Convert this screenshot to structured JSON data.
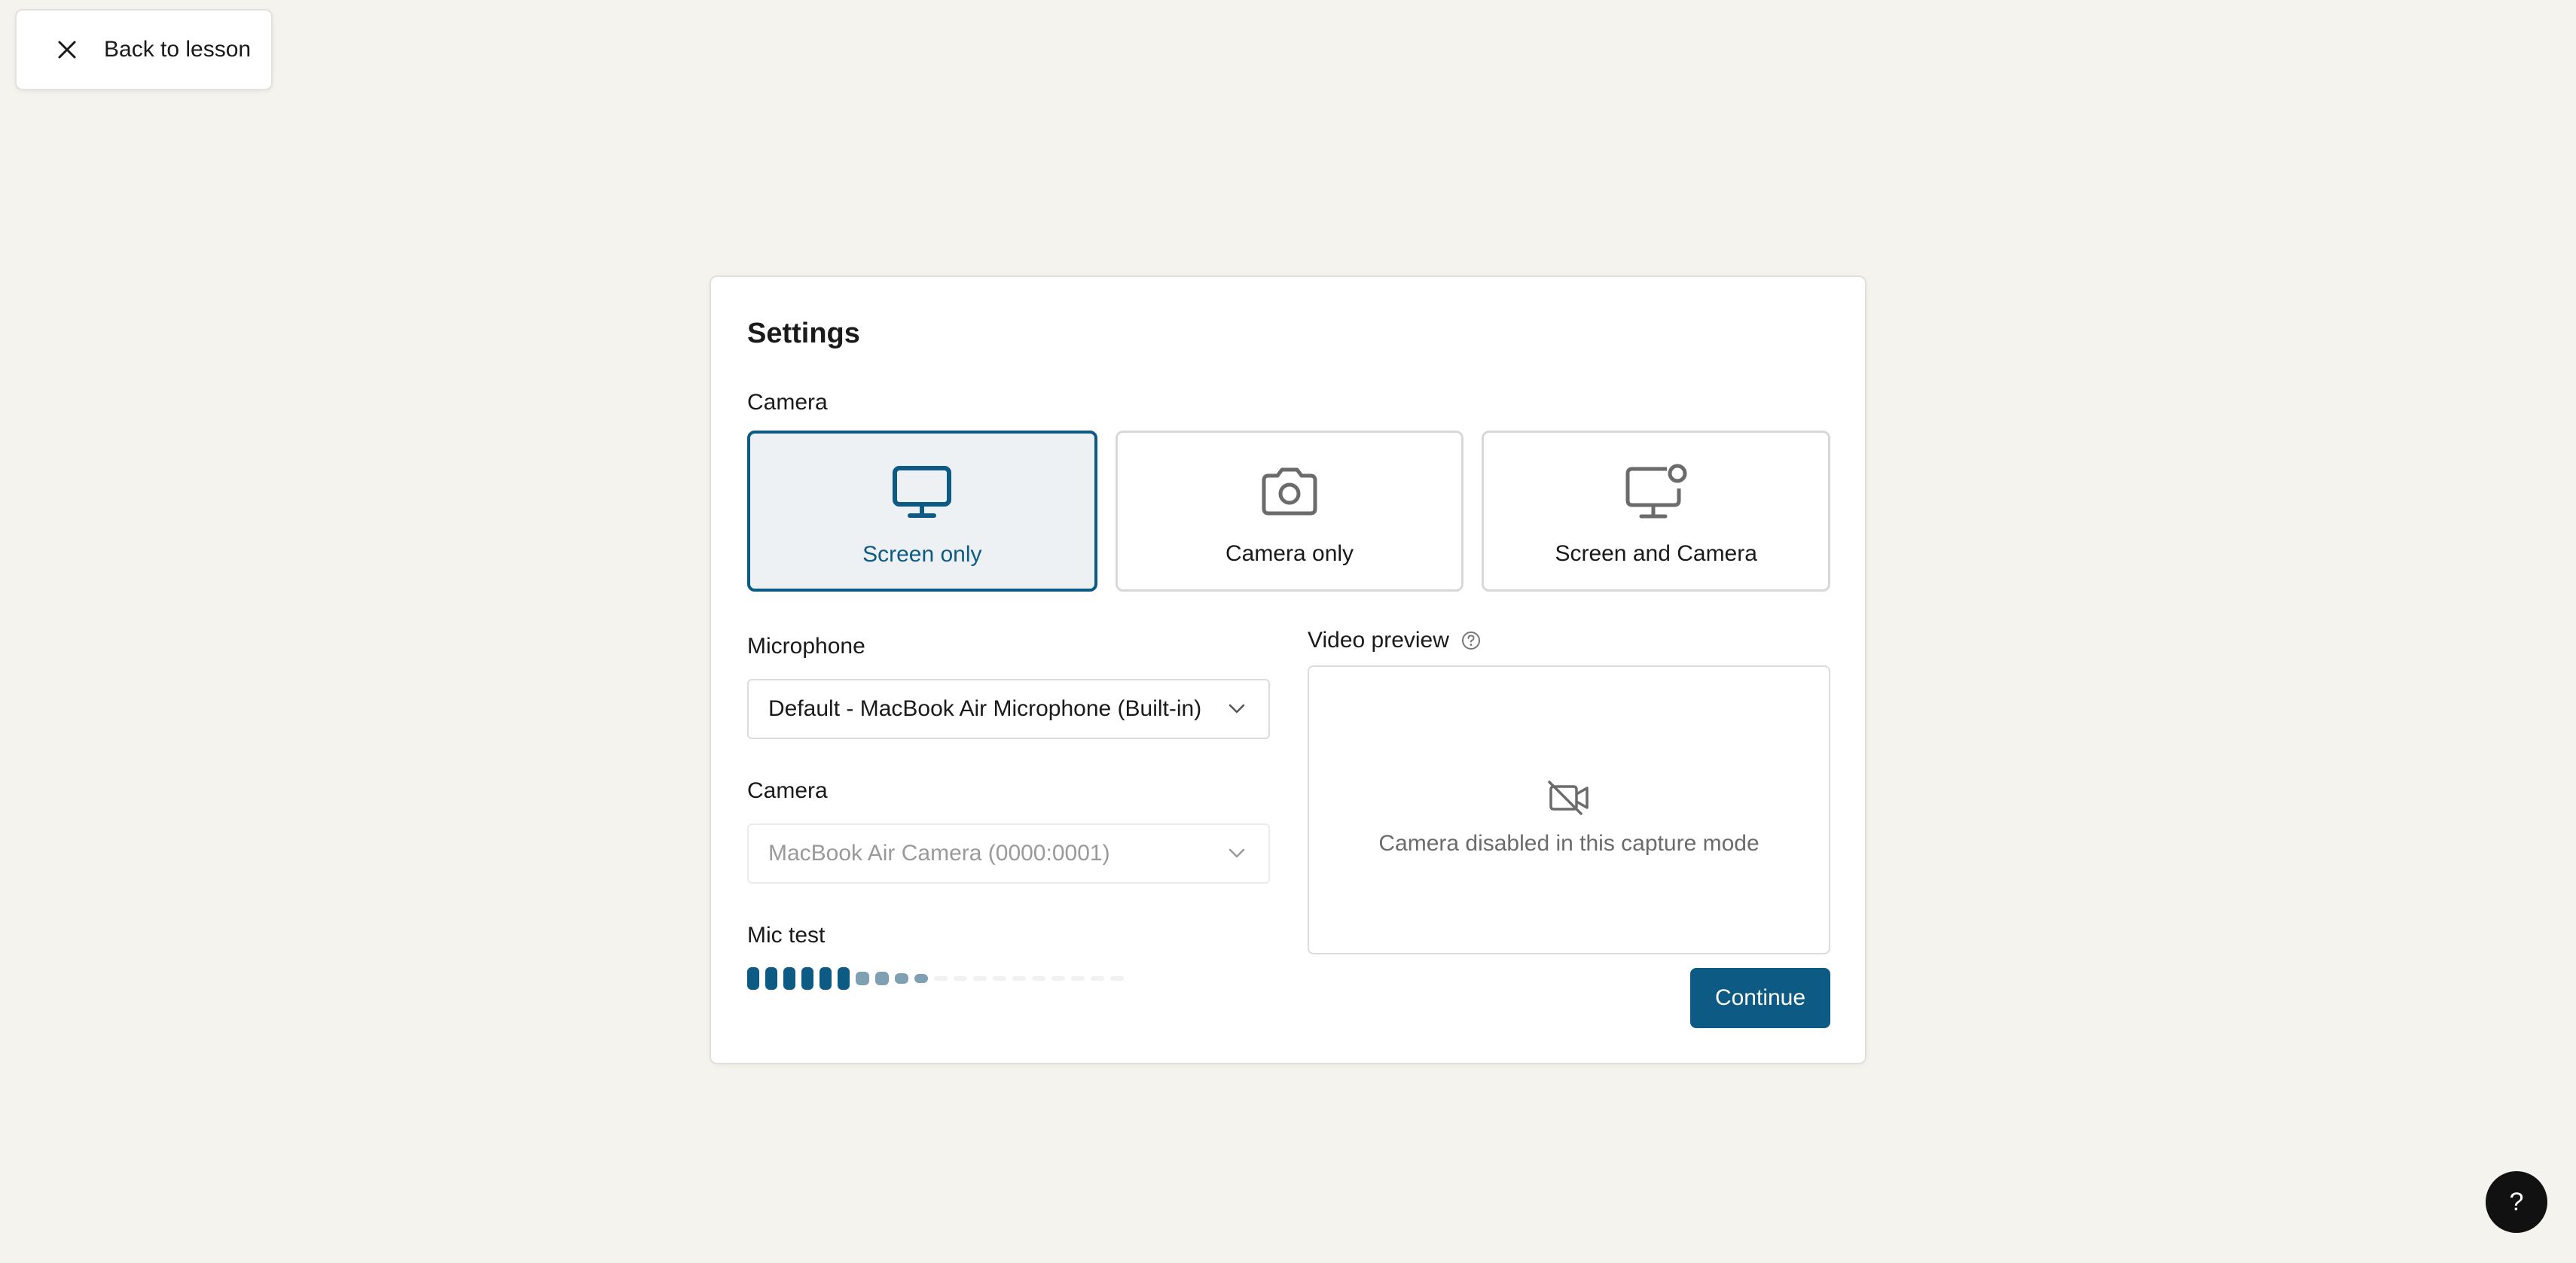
{
  "back_button": {
    "label": "Back to lesson",
    "icon": "close-icon"
  },
  "settings": {
    "title": "Settings",
    "camera_mode_label": "Camera",
    "modes": [
      {
        "label": "Screen only",
        "icon": "monitor-icon",
        "selected": true
      },
      {
        "label": "Camera only",
        "icon": "camera-icon",
        "selected": false
      },
      {
        "label": "Screen and Camera",
        "icon": "monitor-camera-icon",
        "selected": false
      }
    ],
    "microphone": {
      "label": "Microphone",
      "value": "Default - MacBook Air Microphone (Built-in)"
    },
    "camera": {
      "label": "Camera",
      "value": "MacBook Air Camera (0000:0001)",
      "disabled": true
    },
    "mic_test": {
      "label": "Mic test",
      "level_fraction": 0.33
    },
    "video_preview": {
      "label": "Video preview",
      "message": "Camera disabled in this capture mode"
    },
    "continue_label": "Continue"
  },
  "help_fab": {
    "label": "?"
  },
  "colors": {
    "accent": "#0d5b85",
    "background": "#f5f3ee",
    "muted_text": "#6b6b6b"
  }
}
